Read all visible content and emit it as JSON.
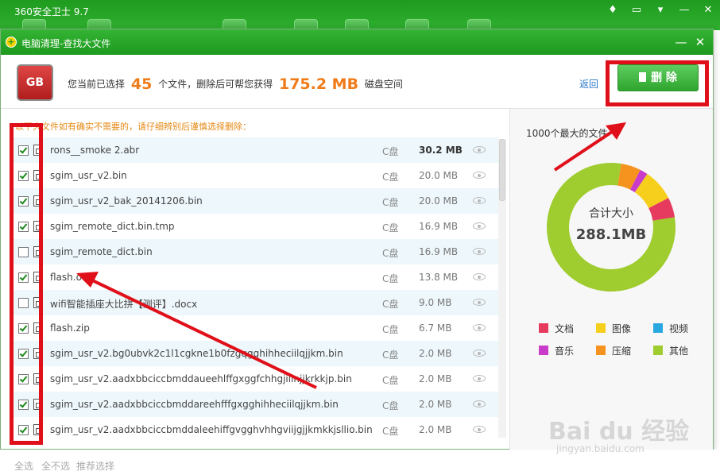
{
  "app": {
    "title": "360安全卫士 9.7"
  },
  "dialog": {
    "title": "电脑清理-查找大文件"
  },
  "summary": {
    "prefix": "您当前已选择",
    "count": "45",
    "mid": "个文件，删除后可帮您获得",
    "size": "175.2 MB",
    "suffix": "磁盘空间",
    "back_label": "返回",
    "delete_label": "删 除"
  },
  "notice": "以下大文件如有确实不需要的，请仔细辨别后谨慎选择删除：",
  "files": [
    {
      "name": "rons__smoke 2.abr",
      "drive": "C盘",
      "size": "30.2 MB",
      "checked": true,
      "bold": true
    },
    {
      "name": "sgim_usr_v2.bin",
      "drive": "C盘",
      "size": "20.0 MB",
      "checked": true
    },
    {
      "name": "sgim_usr_v2_bak_20141206.bin",
      "drive": "C盘",
      "size": "20.0 MB",
      "checked": true
    },
    {
      "name": "sgim_remote_dict.bin.tmp",
      "drive": "C盘",
      "size": "16.9 MB",
      "checked": true
    },
    {
      "name": "sgim_remote_dict.bin",
      "drive": "C盘",
      "size": "16.9 MB",
      "checked": false
    },
    {
      "name": "flash.ocx",
      "drive": "C盘",
      "size": "13.8 MB",
      "checked": true
    },
    {
      "name": "wifi智能插座大比拼【测评】.docx",
      "drive": "C盘",
      "size": "9.0 MB",
      "checked": false
    },
    {
      "name": "flash.zip",
      "drive": "C盘",
      "size": "6.7 MB",
      "checked": true
    },
    {
      "name": "sgim_usr_v2.bg0ubvk2c1l1cgkne1b0fzgqgghihheciilqjjkm.bin",
      "drive": "C盘",
      "size": "2.0 MB",
      "checked": true
    },
    {
      "name": "sgim_usr_v2.aadxbbciccbmddaueehlffgxggfchhgjillnjjkrkkjp.bin",
      "drive": "C盘",
      "size": "2.0 MB",
      "checked": true
    },
    {
      "name": "sgim_usr_v2.aadxbbciccbmddareehfffgxgghihheciilqjjkm.bin",
      "drive": "C盘",
      "size": "2.0 MB",
      "checked": true
    },
    {
      "name": "sgim_usr_v2.aadxbbciccbmddaleehiffgvgghvhhgviijgjjkmkkjsllio.bin",
      "drive": "C盘",
      "size": "2.0 MB",
      "checked": true
    }
  ],
  "panel": {
    "title": "1000个最大的文件",
    "center_label": "合计大小",
    "center_value": "288.1MB",
    "segments": [
      {
        "key": "other",
        "fraction": 0.8,
        "color": "#9fcc2e"
      },
      {
        "key": "compress",
        "fraction": 0.05,
        "color": "#f6921e"
      },
      {
        "key": "music",
        "fraction": 0.02,
        "color": "#c93bc9"
      },
      {
        "key": "image",
        "fraction": 0.08,
        "color": "#f6cf1c"
      },
      {
        "key": "doc",
        "fraction": 0.05,
        "color": "#e63b5e"
      }
    ],
    "legend": [
      {
        "label": "文档",
        "color": "#e63b5e"
      },
      {
        "label": "图像",
        "color": "#f6cf1c"
      },
      {
        "label": "视频",
        "color": "#29a8e0"
      },
      {
        "label": "音乐",
        "color": "#c93bc9"
      },
      {
        "label": "压缩",
        "color": "#f6921e"
      },
      {
        "label": "其他",
        "color": "#9fcc2e"
      }
    ]
  },
  "footer": {
    "select_all": "全选",
    "select_none": "全不选",
    "recommend": "推荐选择"
  },
  "watermark": {
    "brand": "Bai du 经验",
    "url": "jingyan.baidu.com"
  }
}
